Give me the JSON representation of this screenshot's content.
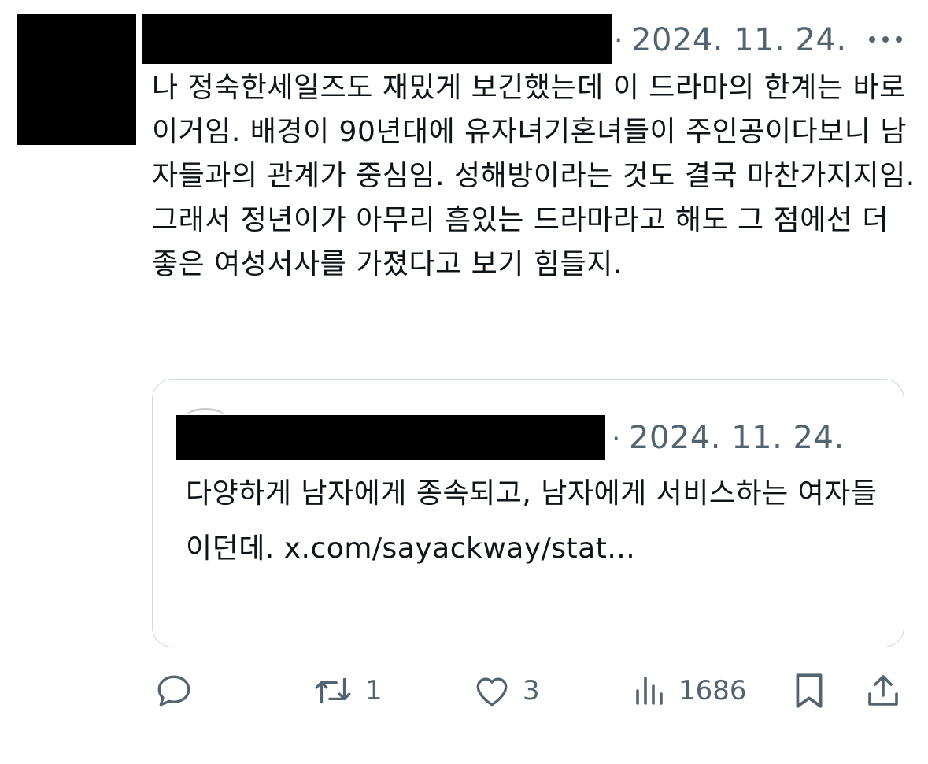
{
  "tweet": {
    "date": "2024. 11. 24.",
    "separator": "·",
    "text": "나 정숙한세일즈도 재밌게 보긴했는데 이 드라마의 한계는 바로 이거임. 배경이 90년대에 유자녀기혼녀들이 주인공이다보니 남자들과의 관계가 중심임. 성해방이라는 것도 결국 마찬가지지임. 그래서 정년이가 아무리 흠있는 드라마라고 해도 그 점에선 더 좋은 여성서사를 가졌다고 보기 힘들지.",
    "more_icon": "ellipsis-icon"
  },
  "quote": {
    "date": "2024. 11. 24.",
    "separator": "·",
    "text": "다양하게 남자에게 종속되고, 남자에게 서비스하는 여자들이던데. x.com/sayackway/stat..."
  },
  "actions": {
    "reply": {
      "icon": "reply-icon",
      "count": ""
    },
    "retweet": {
      "icon": "retweet-icon",
      "count": "1"
    },
    "like": {
      "icon": "heart-icon",
      "count": "3"
    },
    "views": {
      "icon": "views-icon",
      "count": "1686"
    },
    "bookmark": {
      "icon": "bookmark-icon"
    },
    "share": {
      "icon": "share-icon"
    }
  },
  "colors": {
    "text": "#0f1419",
    "secondary": "#536471",
    "border": "#cfd9de",
    "redaction": "#000000"
  }
}
